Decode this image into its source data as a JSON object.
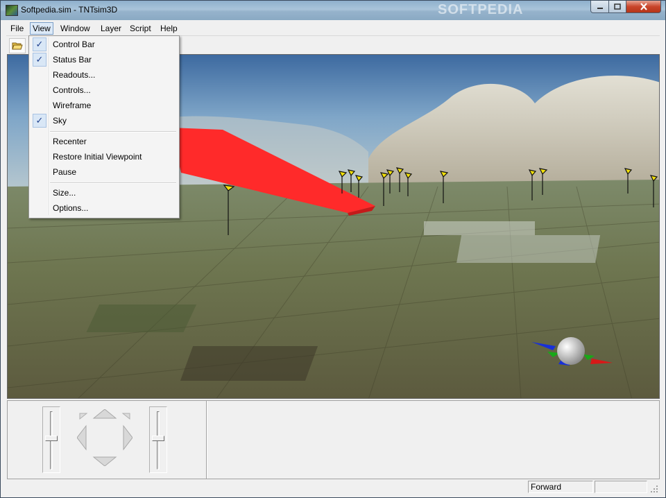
{
  "window": {
    "title": "Softpedia.sim - TNTsim3D",
    "watermark": "SOFTPEDIA",
    "minimize_icon": "minimize-icon",
    "maximize_icon": "maximize-icon",
    "close_icon": "close-icon"
  },
  "menubar": {
    "items": [
      "File",
      "View",
      "Window",
      "Layer",
      "Script",
      "Help"
    ]
  },
  "toolbar": {
    "open_icon": "open-folder-icon"
  },
  "view_menu": {
    "items": [
      {
        "label": "Control Bar",
        "checked": true
      },
      {
        "label": "Status Bar",
        "checked": true
      },
      {
        "label": "Readouts...",
        "checked": false
      },
      {
        "label": "Controls...",
        "checked": false
      },
      {
        "label": "Wireframe",
        "checked": false
      },
      {
        "label": "Sky",
        "checked": true
      },
      {
        "label": "Recenter",
        "checked": false
      },
      {
        "label": "Restore Initial Viewpoint",
        "checked": false
      },
      {
        "label": "Pause",
        "checked": false
      },
      {
        "label": "Size...",
        "checked": false
      },
      {
        "label": "Options...",
        "checked": false
      }
    ],
    "check_glyph": "✓"
  },
  "viewport": {
    "description_icons": [
      "orientation-gizmo-icon",
      "route-ribbon",
      "flag-markers"
    ],
    "colors": {
      "ribbon": "#ff2a2a",
      "flag": "#f2e00a",
      "sky_top": "#3f6fa3",
      "ground": "#6b7a4d"
    }
  },
  "controls": {
    "left_slider": "elevation-slider",
    "dpad": "navigation-pad",
    "right_slider": "speed-slider"
  },
  "statusbar": {
    "mode": "Forward",
    "extra": ""
  }
}
